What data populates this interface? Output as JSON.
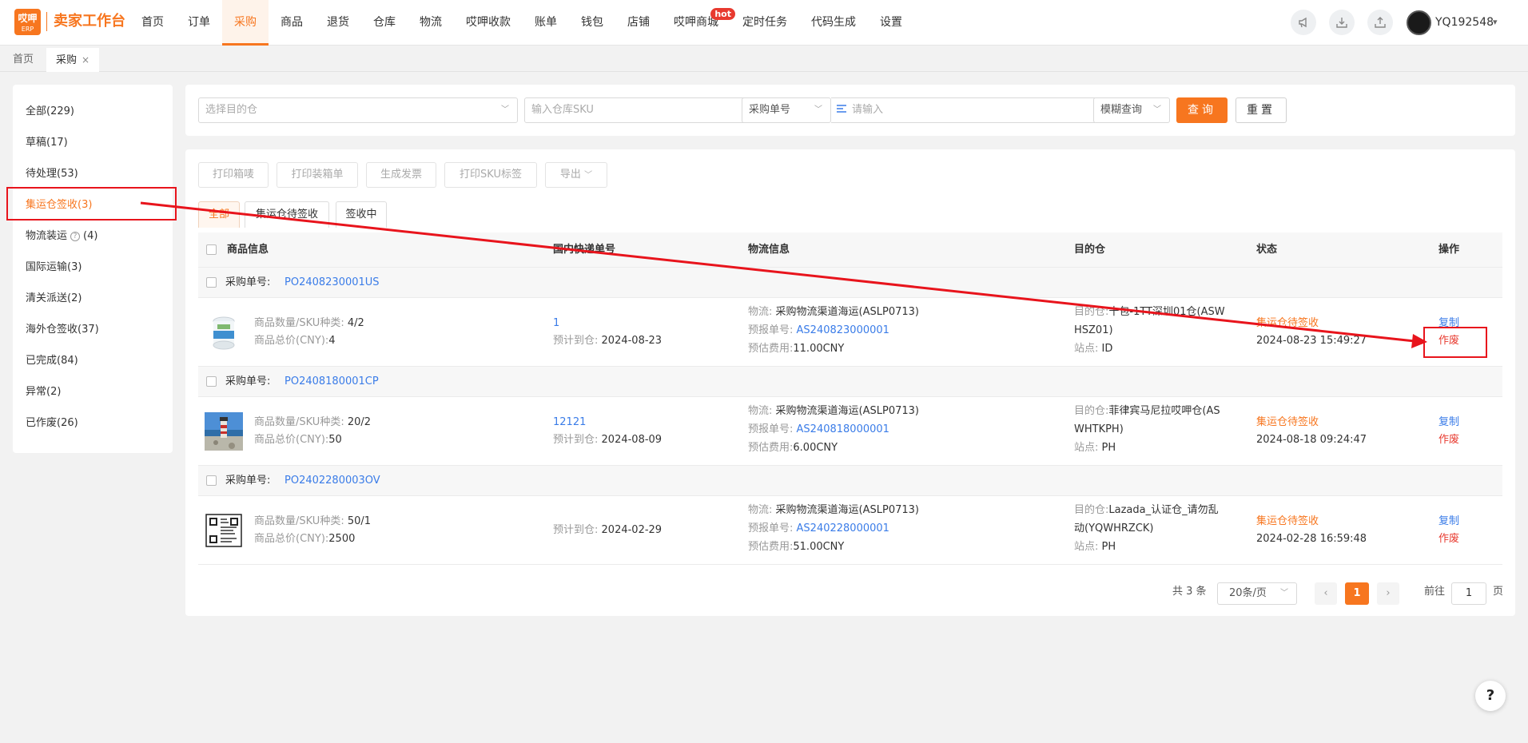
{
  "app": {
    "logo_top": "哎呷",
    "logo_bottom": "ERP",
    "title": "卖家工作台"
  },
  "nav": [
    {
      "label": "首页",
      "active": false
    },
    {
      "label": "订单",
      "active": false
    },
    {
      "label": "采购",
      "active": true
    },
    {
      "label": "商品",
      "active": false
    },
    {
      "label": "退货",
      "active": false
    },
    {
      "label": "仓库",
      "active": false
    },
    {
      "label": "物流",
      "active": false
    },
    {
      "label": "哎呷收款",
      "active": false
    },
    {
      "label": "账单",
      "active": false
    },
    {
      "label": "钱包",
      "active": false
    },
    {
      "label": "店铺",
      "active": false
    },
    {
      "label": "哎呷商城",
      "active": false,
      "badge": "hot"
    },
    {
      "label": "定时任务",
      "active": false
    },
    {
      "label": "代码生成",
      "active": false
    },
    {
      "label": "设置",
      "active": false
    }
  ],
  "toolbar": {
    "icons": [
      "megaphone-icon",
      "download-icon",
      "upload-icon"
    ],
    "username": "YQ192548"
  },
  "page_tabs": [
    {
      "label": "首页",
      "active": false
    },
    {
      "label": "采购",
      "active": true,
      "close": "×"
    }
  ],
  "sidebar": {
    "items": [
      {
        "label": "全部(229)"
      },
      {
        "label": "草稿(17)"
      },
      {
        "label": "待处理(53)"
      },
      {
        "label": "集运仓签收(3)",
        "active": true
      },
      {
        "label": "物流装运",
        "suffix": "(4)",
        "help_icon": "?"
      },
      {
        "label": "国际运输(3)"
      },
      {
        "label": "清关派送(2)"
      },
      {
        "label": "海外仓签收(37)"
      },
      {
        "label": "已完成(84)"
      },
      {
        "label": "异常(2)"
      },
      {
        "label": "已作废(26)"
      }
    ]
  },
  "filters": {
    "warehouse_placeholder": "选择目的仓",
    "sku_placeholder": "输入仓库SKU",
    "search_type": "采购单号",
    "search_placeholder": "请输入",
    "match_mode": "模糊查询",
    "query_label": "查询",
    "reset_label": "重置"
  },
  "actions": [
    "打印箱唛",
    "打印装箱单",
    "生成发票",
    "打印SKU标签",
    "导出"
  ],
  "status_tabs": [
    {
      "label": "全部",
      "active": true
    },
    {
      "label": "集运仓待签收",
      "active": false
    },
    {
      "label": "签收中",
      "active": false
    }
  ],
  "table": {
    "headers": [
      "商品信息",
      "国内快递单号",
      "物流信息",
      "目的仓",
      "状态",
      "操作"
    ],
    "po_label": "采购单号:",
    "qty_label": "商品数量/SKU种类:",
    "total_label": "商品总价(CNY):",
    "eta_label": "预计到仓:",
    "logistics_label": "物流:",
    "prebook_label": "预报单号:",
    "fee_label": "预估费用:",
    "dest_label": "目的仓:",
    "site_label": "站点:",
    "copy_label": "复制",
    "void_label": "作废",
    "orders": [
      {
        "po": "PO2408230001US",
        "thumb": "roll-product",
        "qty": "4/2",
        "total": "4",
        "tracking": "1",
        "eta": "2024-08-23",
        "logistics": "采购物流渠道海运(ASLP0713)",
        "prebook": "AS240823000001",
        "fee": "11.00CNY",
        "dest_line1": "十包-1TT深圳01仓(ASW",
        "dest_line2": "HSZ01)",
        "site": "ID",
        "status": "集运仓待签收",
        "time": "2024-08-23 15:49:27"
      },
      {
        "po": "PO2408180001CP",
        "thumb": "lighthouse-photo",
        "qty": "20/2",
        "total": "50",
        "tracking": "12121",
        "eta": "2024-08-09",
        "logistics": "采购物流渠道海运(ASLP0713)",
        "prebook": "AS240818000001",
        "fee": "6.00CNY",
        "dest_line1": "菲律宾马尼拉哎呷仓(AS",
        "dest_line2": "WHTKPH)",
        "site": "PH",
        "status": "集运仓待签收",
        "time": "2024-08-18 09:24:47"
      },
      {
        "po": "PO2402280003OV",
        "thumb": "document-scan",
        "qty": "50/1",
        "total": "2500",
        "tracking": "",
        "eta": "2024-02-29",
        "logistics": "采购物流渠道海运(ASLP0713)",
        "prebook": "AS240228000001",
        "fee": "51.00CNY",
        "dest_line1": "Lazada_认证仓_请勿乱",
        "dest_line2": "动(YQWHRZCK)",
        "site": "PH",
        "status": "集运仓待签收",
        "time": "2024-02-28 16:59:48"
      }
    ]
  },
  "pagination": {
    "total": "共 3 条",
    "page_size": "20条/页",
    "current": "1",
    "goto_label": "前往",
    "goto_value": "1",
    "page_unit": "页"
  },
  "help": "?",
  "colors": {
    "accent": "#f7761f",
    "link": "#3a7ce8",
    "danger": "#e83a2f",
    "annotation": "#e8141c"
  }
}
